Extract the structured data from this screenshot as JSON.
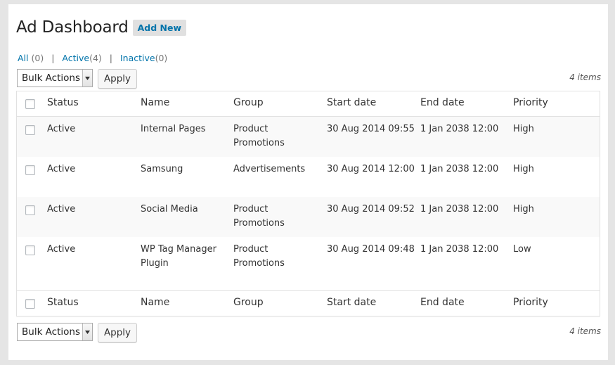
{
  "header": {
    "title": "Ad Dashboard",
    "add_new_label": "Add New"
  },
  "filters": {
    "all_label": "All",
    "all_count": "(0)",
    "active_label": "Active",
    "active_count": "(4)",
    "inactive_label": "Inactive",
    "inactive_count": "(0)",
    "separator": "|"
  },
  "tablenav": {
    "bulk_actions_label": "Bulk Actions",
    "apply_label": "Apply",
    "item_count": "4 items"
  },
  "table": {
    "columns": {
      "status": "Status",
      "name": "Name",
      "group": "Group",
      "start": "Start date",
      "end": "End date",
      "priority": "Priority"
    },
    "rows": [
      {
        "status": "Active",
        "name": "Internal Pages",
        "group": "Product Promotions",
        "start": "30 Aug 2014 09:55",
        "end": "1 Jan 2038 12:00",
        "priority": "High"
      },
      {
        "status": "Active",
        "name": "Samsung",
        "group": "Advertisements",
        "start": "30 Aug 2014 12:00",
        "end": "1 Jan 2038 12:00",
        "priority": "High"
      },
      {
        "status": "Active",
        "name": "Social Media",
        "group": "Product Promotions",
        "start": "30 Aug 2014 09:52",
        "end": "1 Jan 2038 12:00",
        "priority": "High"
      },
      {
        "status": "Active",
        "name": "WP Tag Manager Plugin",
        "group": "Product Promotions",
        "start": "30 Aug 2014 09:48",
        "end": "1 Jan 2038 12:00",
        "priority": "Low"
      }
    ]
  },
  "icons": {
    "dropdown_arrow": "chevron-down-icon",
    "checkbox": "checkbox-icon"
  },
  "colors": {
    "link": "#0073aa",
    "background": "#e5e5e5",
    "alt_row": "#f9f9f9"
  }
}
